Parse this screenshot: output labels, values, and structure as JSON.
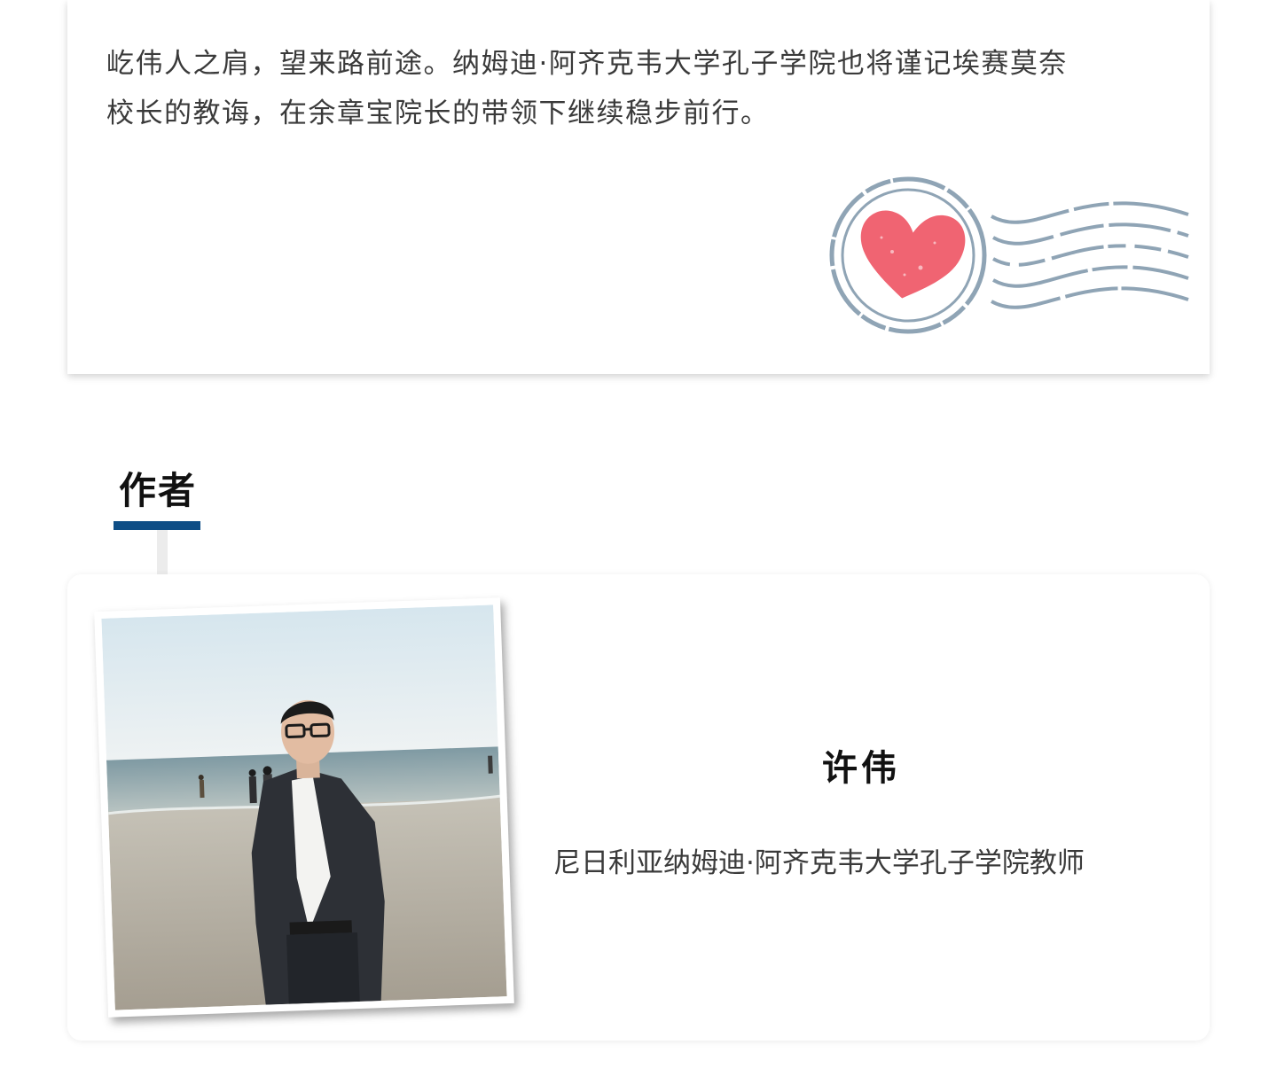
{
  "letter": {
    "line1": "屹伟人之肩，望来路前途。纳姆迪·阿齐克韦大学孔子学院也将谨记埃赛莫奈",
    "line2": "校长的教诲，在余章宝院长的带领下继续稳步前行。",
    "stamp_icon": "heart-postmark-icon",
    "stamp_heart_color": "#f06472",
    "stamp_line_color": "#8fa4b5"
  },
  "author_section": {
    "heading": "作者",
    "accent_color": "#0e4e86",
    "name": "许伟",
    "title": "尼日利亚纳姆迪·阿齐克韦大学孔子学院教师",
    "photo": "author-portrait-beach"
  }
}
